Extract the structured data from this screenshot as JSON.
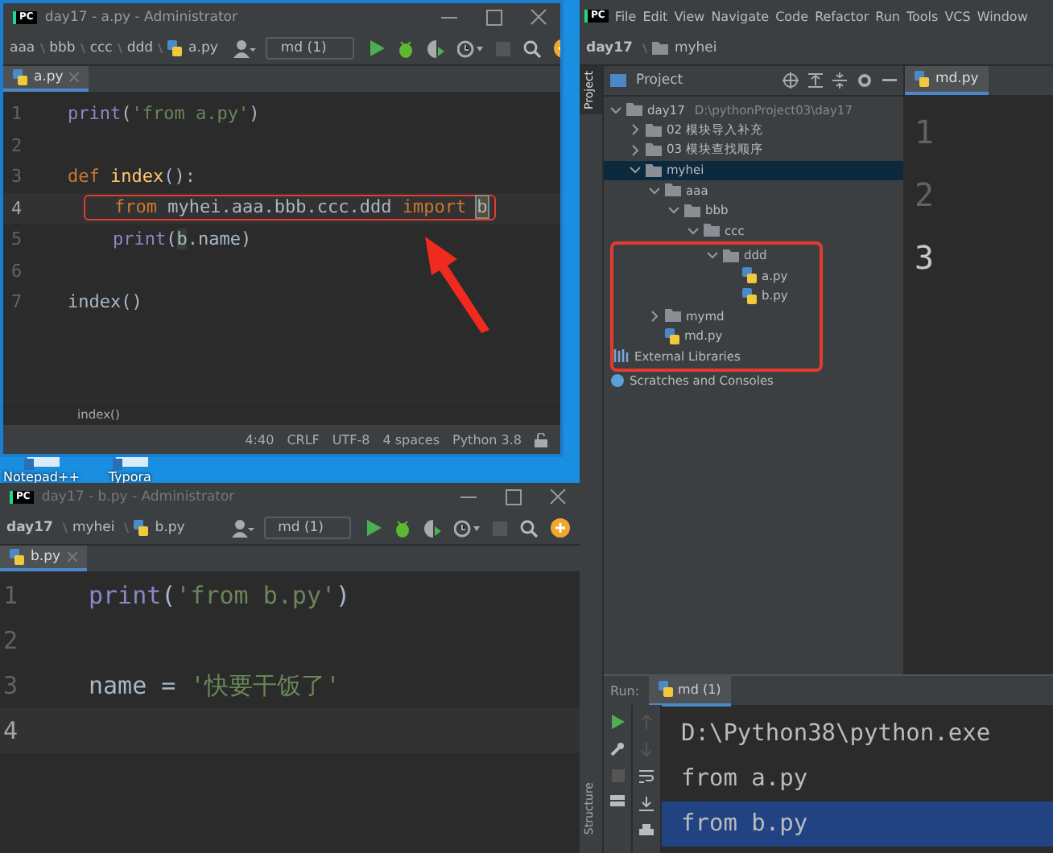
{
  "desktop": {
    "icons": [
      {
        "label": "Notepad++"
      },
      {
        "label": "Typora"
      }
    ]
  },
  "window_a": {
    "logo": "PC",
    "title": "day17 - a.py - Administrator",
    "breadcrumbs": [
      "aaa",
      "bbb",
      "ccc",
      "ddd",
      "a.py"
    ],
    "run_config": "md (1)",
    "tabs": [
      {
        "label": "a.py",
        "selected": true
      }
    ],
    "lines": [
      {
        "number": "1",
        "current": false,
        "boxed": false,
        "indented": false,
        "tokens": [
          {
            "kind": "builtin",
            "text": "print"
          },
          {
            "kind": "plain",
            "text": "("
          },
          {
            "kind": "string",
            "text": "'from a.py'"
          },
          {
            "kind": "plain",
            "text": ")"
          }
        ]
      },
      {
        "number": "2",
        "current": false
      },
      {
        "number": "3",
        "current": false,
        "boxed": false,
        "indented": false,
        "tokens": [
          {
            "kind": "keyword",
            "text": "def"
          },
          {
            "kind": "function",
            "text": " index"
          },
          {
            "kind": "plain",
            "text": "():"
          }
        ]
      },
      {
        "number": "4",
        "current": true,
        "boxed": true,
        "indented": true,
        "tokens": [
          {
            "kind": "keyword",
            "text": "from"
          },
          {
            "kind": "plain",
            "text": " myhei.aaa.bbb.ccc.ddd "
          },
          {
            "kind": "keyword",
            "text": "import"
          },
          {
            "kind": "caret",
            "text": "b"
          }
        ]
      },
      {
        "number": "5",
        "current": false,
        "boxed": false,
        "indented": true,
        "tokens": [
          {
            "kind": "builtin",
            "text": "print"
          },
          {
            "kind": "plain",
            "text": "("
          },
          {
            "kind": "usage",
            "text": "b"
          },
          {
            "kind": "plain",
            "text": ".name)"
          }
        ]
      },
      {
        "number": "6",
        "current": false
      },
      {
        "number": "7",
        "current": false,
        "boxed": false,
        "indented": false,
        "tokens": [
          {
            "kind": "plain",
            "text": "index()"
          }
        ]
      }
    ],
    "footer": "index()",
    "status": [
      "4:40",
      "CRLF",
      "UTF-8",
      "4 spaces",
      "Python 3.8"
    ],
    "arrow": true
  },
  "window_b": {
    "logo": "PC",
    "title": "day17 - b.py - Administrator",
    "breadcrumbs": [
      "day17",
      "myhei",
      "b.py"
    ],
    "run_config": "md (1)",
    "tabs": [
      {
        "label": "b.py",
        "selected": true
      }
    ],
    "lines": [
      {
        "number": "1",
        "current": false,
        "tokens": [
          {
            "kind": "builtin",
            "text": "print"
          },
          {
            "kind": "plain",
            "text": "("
          },
          {
            "kind": "string",
            "text": "'from b.py'"
          },
          {
            "kind": "plain",
            "text": ")"
          }
        ]
      },
      {
        "number": "2",
        "current": false
      },
      {
        "number": "3",
        "current": false,
        "tokens": [
          {
            "kind": "plain",
            "text": "name = "
          },
          {
            "kind": "string",
            "text": "'快要干饭了'"
          }
        ]
      },
      {
        "number": "4",
        "current": true
      }
    ]
  },
  "window_c": {
    "logo": "PC",
    "menu": [
      "File",
      "Edit",
      "View",
      "Navigate",
      "Code",
      "Refactor",
      "Run",
      "Tools",
      "VCS",
      "Window"
    ],
    "breadcrumbs": [
      "day17",
      "myhei"
    ],
    "side_tabs": [
      "Project",
      "Structure"
    ],
    "panel_title": "Project",
    "editor_tabs": [
      {
        "label": "md.py",
        "selected": true
      }
    ],
    "tree": [
      {
        "name": "day17",
        "path": "D:\\pythonProject03\\day17",
        "kind": "folder",
        "expanded": true,
        "selected": false,
        "boxed": false,
        "children": [
          {
            "name": "02 模块导入补充",
            "kind": "folder",
            "expanded": false,
            "selected": false,
            "boxed": false
          },
          {
            "name": "03 模块查找顺序",
            "kind": "folder",
            "expanded": false,
            "selected": false,
            "boxed": false
          },
          {
            "name": "myhei",
            "kind": "folder",
            "expanded": true,
            "selected": true,
            "boxed": false,
            "children": [
              {
                "name": "aaa",
                "kind": "folder",
                "expanded": true,
                "selected": false,
                "boxed": false,
                "children": [
                  {
                    "name": "bbb",
                    "kind": "folder",
                    "expanded": true,
                    "selected": false,
                    "boxed": false,
                    "children": [
                      {
                        "name": "ccc",
                        "kind": "folder",
                        "expanded": true,
                        "selected": false,
                        "boxed": false,
                        "children": [
                          {
                            "name": "ddd",
                            "kind": "folder",
                            "expanded": true,
                            "selected": false,
                            "boxed": true,
                            "children": [
                              {
                                "name": "a.py",
                                "kind": "python",
                                "selected": false,
                                "boxed": true
                              },
                              {
                                "name": "b.py",
                                "kind": "python",
                                "selected": false,
                                "boxed": true
                              }
                            ]
                          }
                        ]
                      }
                    ]
                  }
                ]
              },
              {
                "name": "mymd",
                "kind": "folder",
                "expanded": false,
                "selected": false,
                "boxed": true
              },
              {
                "name": "md.py",
                "kind": "python",
                "selected": false,
                "boxed": true
              }
            ]
          }
        ]
      },
      {
        "name": "External Libraries",
        "kind": "libraries",
        "selected": false,
        "boxed": true
      },
      {
        "name": "Scratches and Consoles",
        "kind": "scratches",
        "selected": false,
        "boxed": false
      }
    ],
    "editor_lines": [
      {
        "number": "1",
        "current": false
      },
      {
        "number": "2",
        "current": false
      },
      {
        "number": "3",
        "current": true
      }
    ],
    "run": {
      "label": "Run:",
      "tabs": [
        {
          "label": "md (1)",
          "selected": true
        }
      ],
      "output": [
        {
          "text": "D:\\Python38\\python.exe",
          "selected": false
        },
        {
          "text": "from a.py",
          "selected": false
        },
        {
          "text": "from b.py",
          "selected": true
        }
      ]
    }
  }
}
